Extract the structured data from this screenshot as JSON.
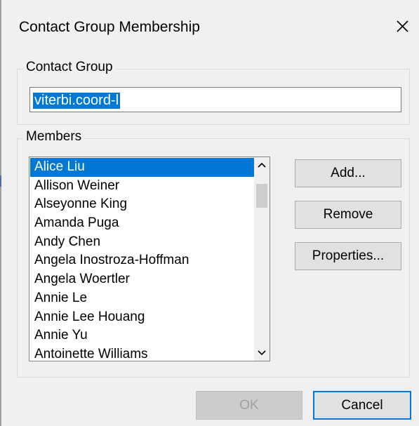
{
  "dialog": {
    "title": "Contact Group Membership",
    "close_icon": "close-icon"
  },
  "contact_group": {
    "legend": "Contact Group",
    "value": "viterbi.coord-l"
  },
  "members": {
    "legend": "Members",
    "items": [
      "Alice Liu",
      "Allison Weiner",
      "Alseyonne King",
      "Amanda Puga",
      "Andy Chen",
      "Angela Inostroza-Hoffman",
      "Angela Woertler",
      "Annie Le",
      "Annie Lee Houang",
      "Annie Yu",
      "Antoinette Williams"
    ],
    "selected_index": 0
  },
  "buttons": {
    "add": "Add...",
    "remove": "Remove",
    "properties": "Properties...",
    "ok": "OK",
    "cancel": "Cancel"
  },
  "colors": {
    "selection": "#0078d7",
    "dialog_bg": "#f0f0f0"
  }
}
